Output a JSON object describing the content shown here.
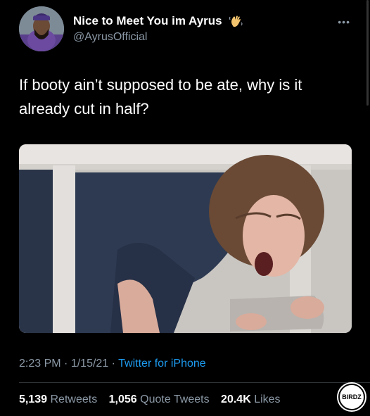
{
  "tweet": {
    "display_name": "Nice to Meet You im Ayrus",
    "handle": "@AyrusOfficial",
    "text": "If booty ain’t supposed to be ate, why is it already cut in half?",
    "time": "2:23 PM",
    "date": "1/15/21",
    "source": "Twitter for iPhone",
    "retweets": "5,139",
    "retweets_label": "Retweets",
    "quotes": "1,056",
    "quotes_label": "Quote Tweets",
    "likes": "20.4K",
    "likes_label": "Likes"
  },
  "watermark": {
    "text": "BIRDZ"
  },
  "icons": {
    "avatar": "profile-avatar",
    "wave": "waving-hand-emoji",
    "more": "more-dots-icon"
  },
  "colors": {
    "background": "#000000",
    "secondary_text": "#8b98a5",
    "link": "#1d9bf0"
  }
}
